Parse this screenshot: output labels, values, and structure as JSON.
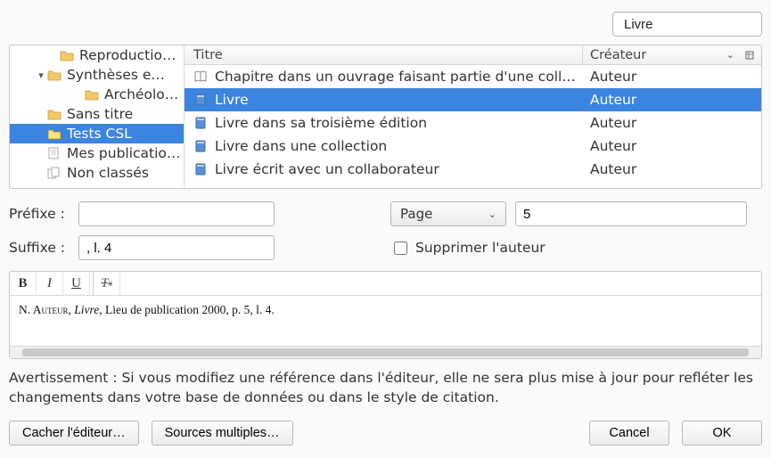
{
  "search": {
    "value": "Livre"
  },
  "tree": [
    {
      "depth": "d1",
      "twisty": "",
      "icon": "folder",
      "label": "Reproductio…"
    },
    {
      "depth": "d1",
      "twisty": "▾",
      "icon": "folder",
      "label": "Synthèses e…"
    },
    {
      "depth": "d2",
      "twisty": "",
      "icon": "folder",
      "label": "Archéolo…"
    },
    {
      "depth": "d0",
      "twisty": "",
      "icon": "folder",
      "label": "Sans titre"
    },
    {
      "depth": "d0",
      "twisty": "",
      "icon": "folder",
      "label": "Tests CSL",
      "selected": true
    },
    {
      "depth": "d0",
      "twisty": "",
      "icon": "pub",
      "label": "Mes publicatio…"
    },
    {
      "depth": "d0",
      "twisty": "",
      "icon": "dup",
      "label": "Non classés"
    }
  ],
  "columns": {
    "title": "Titre",
    "creator": "Créateur"
  },
  "items": [
    {
      "icon": "chapter",
      "title": "Chapitre dans un ouvrage faisant partie d'une coll…",
      "creator": "Auteur"
    },
    {
      "icon": "book",
      "title": "Livre",
      "creator": "Auteur",
      "selected": true
    },
    {
      "icon": "book",
      "title": "Livre dans sa troisième édition",
      "creator": "Auteur"
    },
    {
      "icon": "book",
      "title": "Livre dans une collection",
      "creator": "Auteur"
    },
    {
      "icon": "book",
      "title": "Livre écrit avec un collaborateur",
      "creator": "Auteur"
    }
  ],
  "labels": {
    "prefix": "Préfixe :",
    "suffix": "Suffixe :",
    "suppress": "Supprimer l'auteur"
  },
  "values": {
    "prefix": "",
    "suffix": ", l. 4",
    "locator_type": "Page",
    "locator_value": "5"
  },
  "preview": {
    "author_sc": "N. Auteur",
    "sep1": ", ",
    "title_it": "Livre",
    "rest": ", Lieu de publication 2000, p. 5, l. 4."
  },
  "warning": "Avertissement : Si vous modifiez une référence dans l'éditeur, elle ne sera plus mise à jour pour refléter les changements dans votre base de données ou dans le style de citation.",
  "buttons": {
    "hide": "Cacher l'éditeur…",
    "multiple": "Sources multiples…",
    "cancel": "Cancel",
    "ok": "OK"
  }
}
